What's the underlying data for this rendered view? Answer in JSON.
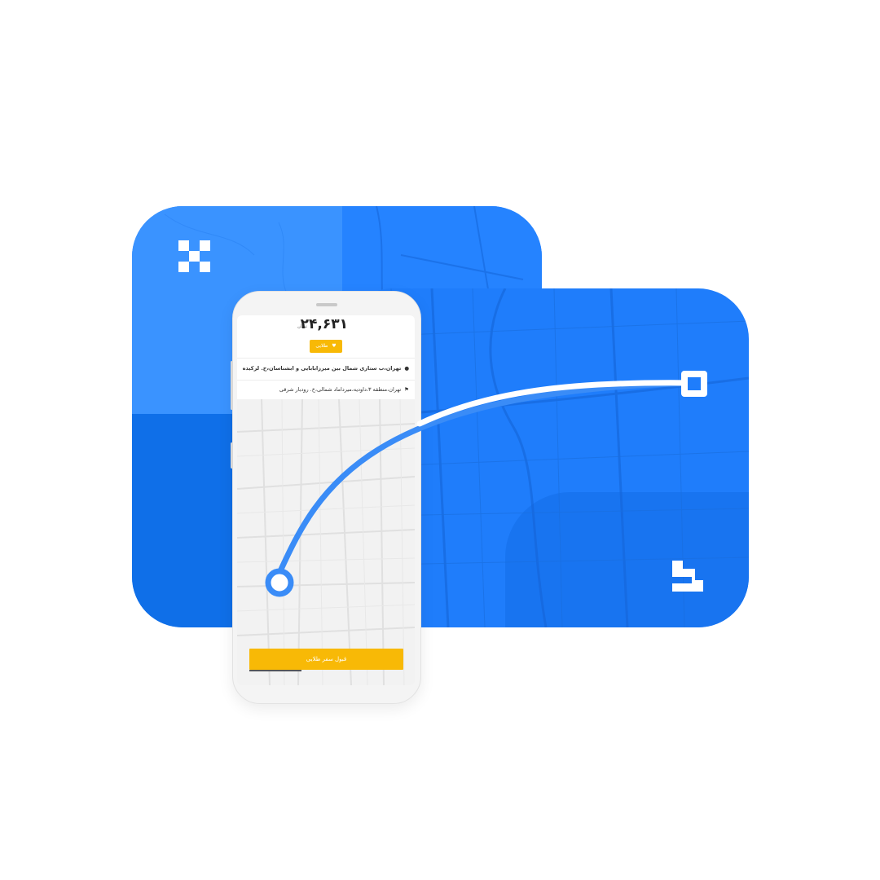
{
  "colors": {
    "brand_blue": "#1f7dfb",
    "accent_yellow": "#f8b906",
    "route_blue": "#3a8cf7",
    "route_white": "#ffffff"
  },
  "icons": {
    "brand_logo_left": "checker-x-logo",
    "brand_logo_right": "bracket-logo",
    "origin_icon": "user-icon",
    "destination_icon": "flag-icon",
    "badge_icon": "heart-icon"
  },
  "ride": {
    "price": "۲۴,۶۳۱",
    "currency": "تومان",
    "badge_label": "طلایی",
    "origin": "تهران،ب ستاری شمال بین میرزابابایی و ابشناسان،خ. لرکیده",
    "destination": "تهران،منطقه ۳،داودیه،میرداماد شمالی،خ. رودبار شرقی",
    "accept_button": "قبول سفر طلایی"
  }
}
